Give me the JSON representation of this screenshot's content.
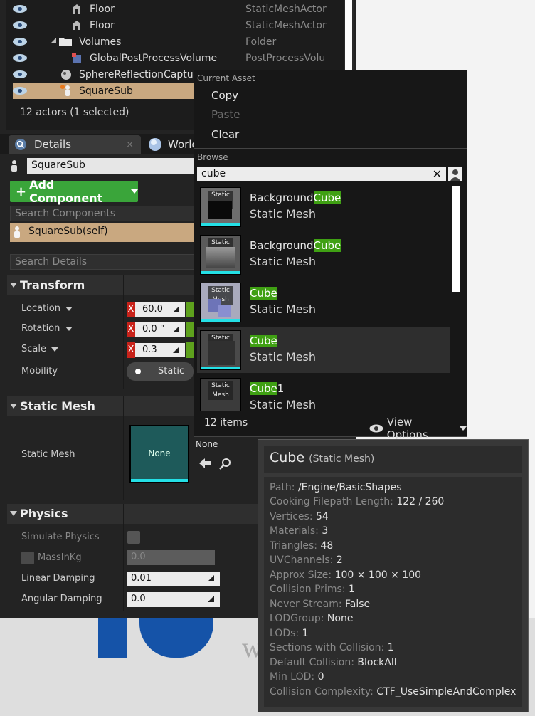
{
  "outliner": {
    "rows": [
      {
        "name": "Floor",
        "type": "StaticMeshActor"
      },
      {
        "name": "Floor",
        "type": "StaticMeshActor"
      },
      {
        "name": "Volumes",
        "type": "Folder"
      },
      {
        "name": "GlobalPostProcessVolume",
        "type": "PostProcessVolu"
      },
      {
        "name": "SphereReflectionCapture",
        "type": ""
      },
      {
        "name": "SquareSub",
        "type": ""
      }
    ],
    "actor_count": "12 actors (1 selected)"
  },
  "tabs": {
    "details": "Details",
    "world": "World"
  },
  "details": {
    "actor_name": "SquareSub",
    "add_component": "Add Component",
    "search_components": "Search Components",
    "self_component": "SquareSub(self)",
    "search_details": "Search Details"
  },
  "transform": {
    "title": "Transform",
    "location_label": "Location",
    "location_x": "60.0",
    "rotation_label": "Rotation",
    "rotation_x": "0.0 °",
    "scale_label": "Scale",
    "scale_x": "0.3",
    "mobility_label": "Mobility",
    "mobility_value": "Static",
    "x_tag": "X"
  },
  "static_mesh": {
    "title": "Static Mesh",
    "label": "Static Mesh",
    "thumb_text": "None",
    "value": "None"
  },
  "physics": {
    "title": "Physics",
    "simulate": "Simulate Physics",
    "mass": "MassInKg",
    "mass_value": "0.0",
    "linear_label": "Linear Damping",
    "linear_value": "0.01",
    "angular_label": "Angular Damping",
    "angular_value": "0.0"
  },
  "popup": {
    "current_asset": "Current Asset",
    "copy": "Copy",
    "paste": "Paste",
    "clear": "Clear",
    "browse": "Browse",
    "search_value": "cube",
    "thumb_tag": "Static Mesh",
    "assets": [
      {
        "pre": "Background",
        "hl": "Cube",
        "post": "",
        "type": "Static Mesh"
      },
      {
        "pre": "Background",
        "hl": "Cube",
        "post": "",
        "type": "Static Mesh"
      },
      {
        "pre": "",
        "hl": "Cube",
        "post": "",
        "type": "Static Mesh"
      },
      {
        "pre": "",
        "hl": "Cube",
        "post": "",
        "type": "Static Mesh"
      },
      {
        "pre": "",
        "hl": "Cube",
        "post": "1",
        "type": "Static Mesh"
      }
    ],
    "item_count": "12 items",
    "view_options": "View Options"
  },
  "tooltip": {
    "title": "Cube",
    "subtitle": "(Static Mesh)",
    "lines": [
      {
        "k": "Path:",
        "v": "/Engine/BasicShapes"
      },
      {
        "k": "Cooking Filepath Length:",
        "v": "122 / 260"
      },
      {
        "k": "Vertices:",
        "v": "54"
      },
      {
        "k": "Materials:",
        "v": "3"
      },
      {
        "k": "Triangles:",
        "v": "48"
      },
      {
        "k": "UVChannels:",
        "v": "2"
      },
      {
        "k": "Approx Size:",
        "v": "100 × 100 × 100"
      },
      {
        "k": "Collision Prims:",
        "v": "1"
      },
      {
        "k": "Never Stream:",
        "v": "False"
      },
      {
        "k": "LODGroup:",
        "v": "None"
      },
      {
        "k": "LODs:",
        "v": "1"
      },
      {
        "k": "Sections with Collision:",
        "v": "1"
      },
      {
        "k": "Default Collision:",
        "v": "BlockAll"
      },
      {
        "k": "Min LOD:",
        "v": "0"
      },
      {
        "k": "Collision Complexity:",
        "v": "CTF_UseSimpleAndComplex"
      }
    ]
  },
  "colors": {
    "selection": "#c9a880",
    "accent_green": "#3aa53a",
    "highlight": "#3fa013",
    "cyan": "#24e0e6"
  }
}
